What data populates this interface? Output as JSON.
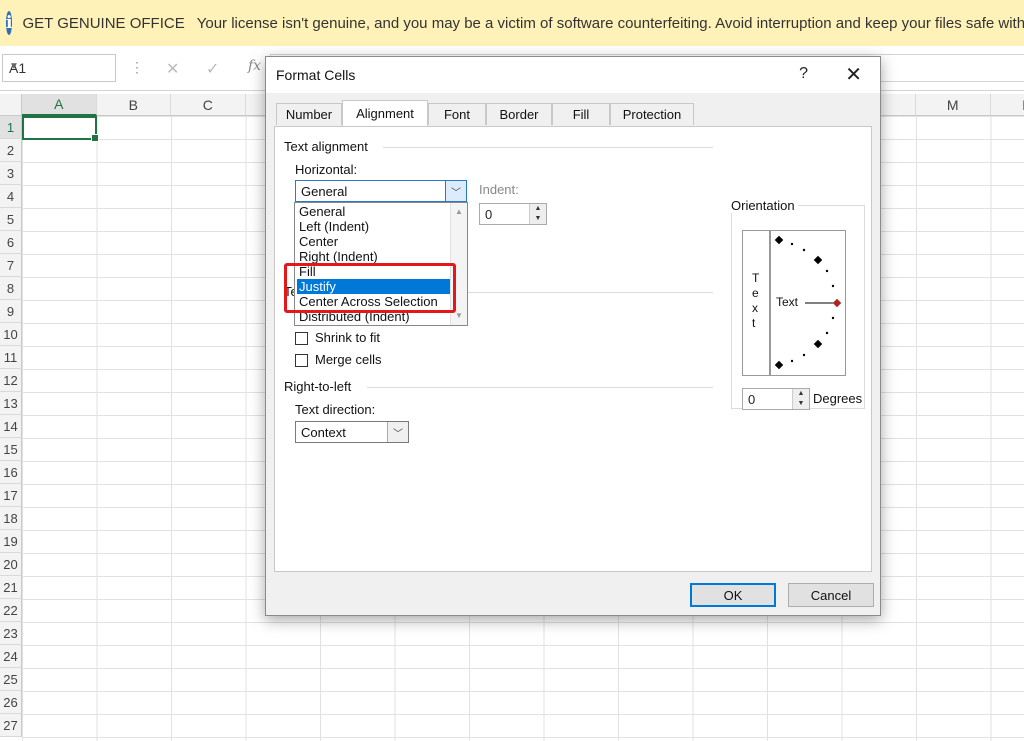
{
  "banner": {
    "title": "GET GENUINE OFFICE",
    "message": "Your license isn't genuine, and you may be a victim of software counterfeiting. Avoid interruption and keep your files safe with genuine O",
    "icon": "info-icon"
  },
  "formula_bar": {
    "name_box": "A1",
    "fx": "fx"
  },
  "sheet": {
    "columns": [
      "A",
      "B",
      "C",
      "",
      "",
      "",
      "",
      "",
      "",
      "",
      "",
      "",
      "M",
      "N"
    ],
    "rows": [
      "1",
      "2",
      "3",
      "4",
      "5",
      "6",
      "7",
      "8",
      "9",
      "10",
      "11",
      "12",
      "13",
      "14",
      "15",
      "16",
      "17",
      "18",
      "19",
      "20",
      "21",
      "22",
      "23",
      "24",
      "25",
      "26",
      "27"
    ],
    "active_cell": "A1",
    "accent_color": "#217346"
  },
  "dialog": {
    "title": "Format Cells",
    "help": "?",
    "close": "✕",
    "tabs": [
      "Number",
      "Alignment",
      "Font",
      "Border",
      "Fill",
      "Protection"
    ],
    "active_tab": "Alignment",
    "text_alignment": {
      "section": "Text alignment",
      "horizontal_label": "Horizontal:",
      "horizontal_value": "General",
      "indent_label": "Indent:",
      "indent_value": "0",
      "options": [
        "General",
        "Left (Indent)",
        "Center",
        "Right (Indent)",
        "Fill",
        "Justify",
        "Center Across Selection",
        "Distributed (Indent)"
      ],
      "selected_option": "Justify",
      "partial_text_control": "Te"
    },
    "text_control": {
      "shrink_to_fit": "Shrink to fit",
      "merge_cells": "Merge cells"
    },
    "rtl": {
      "section": "Right-to-left",
      "direction_label": "Text direction:",
      "direction_value": "Context"
    },
    "orientation": {
      "section": "Orientation",
      "vertical_letters": [
        "T",
        "e",
        "x",
        "t"
      ],
      "dial_text": "Text",
      "degrees_value": "0",
      "degrees_label": "Degrees"
    },
    "buttons": {
      "ok": "OK",
      "cancel": "Cancel"
    },
    "highlight_color": "#e11919",
    "selection_color": "#0078d7"
  }
}
